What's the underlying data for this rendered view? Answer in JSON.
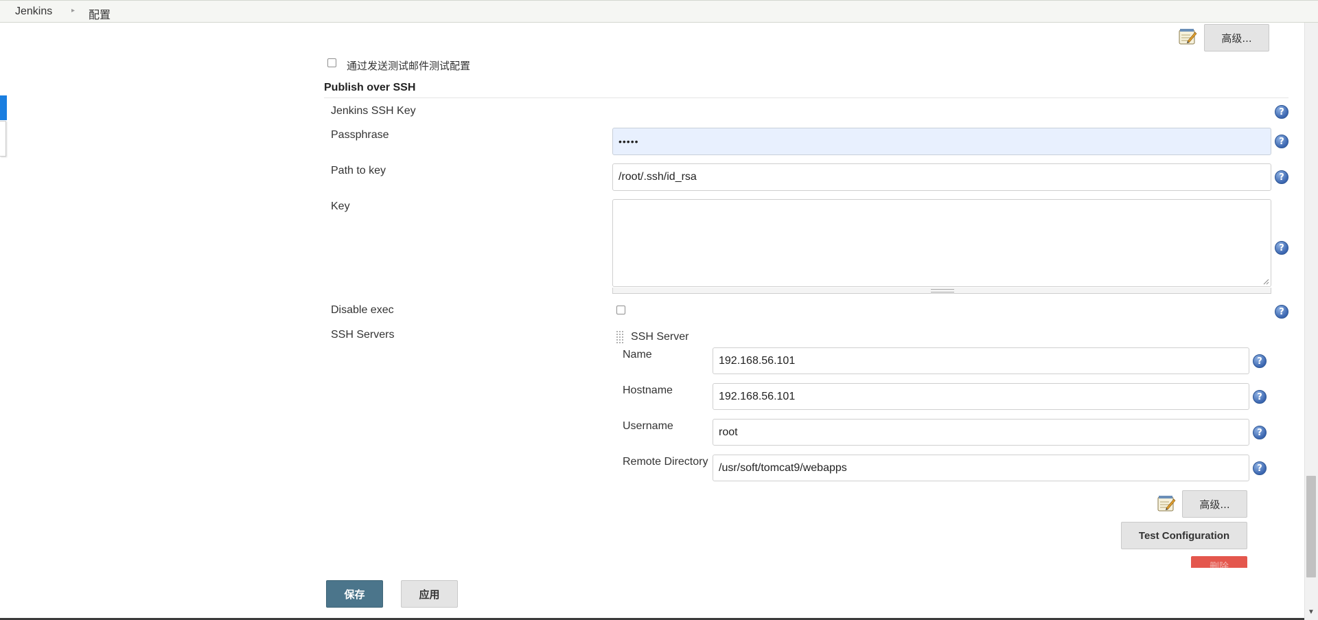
{
  "breadcrumb": {
    "items": [
      "Jenkins",
      "配置"
    ],
    "separator": "▸"
  },
  "email_test": {
    "checkbox_label": "通过发送测试邮件测试配置",
    "checked": false
  },
  "top_advanced_button": "高级...",
  "publish_over_ssh": {
    "title": "Publish over SSH",
    "jenkins_ssh_key_label": "Jenkins SSH Key",
    "passphrase_label": "Passphrase",
    "passphrase_value": "•••••",
    "path_to_key_label": "Path to key",
    "path_to_key_value": "/root/.ssh/id_rsa",
    "key_label": "Key",
    "key_value": "",
    "disable_exec_label": "Disable exec",
    "disable_exec_checked": false,
    "ssh_servers_label": "SSH Servers"
  },
  "ssh_server": {
    "header": "SSH Server",
    "name_label": "Name",
    "name_value": "192.168.56.101",
    "hostname_label": "Hostname",
    "hostname_value": "192.168.56.101",
    "username_label": "Username",
    "username_value": "root",
    "remote_directory_label": "Remote Directory",
    "remote_directory_value": "/usr/soft/tomcat9/webapps",
    "advanced_button": "高级...",
    "test_configuration_button": "Test Configuration",
    "delete_button": "删除"
  },
  "footer": {
    "save_button": "保存",
    "apply_button": "应用"
  },
  "colors": {
    "save_button_bg": "#4b758b",
    "delete_button_bg": "#e4574d",
    "help_icon": "#3b66b0",
    "passphrase_autofill_bg": "#e8f0fe",
    "sidebar_accent": "#1a7ee0"
  },
  "icons": {
    "help": "help-icon",
    "notepad": "notepad-icon",
    "drag_handle": "drag-handle-icon",
    "breadcrumb_chevron": "chevron-right-icon"
  }
}
